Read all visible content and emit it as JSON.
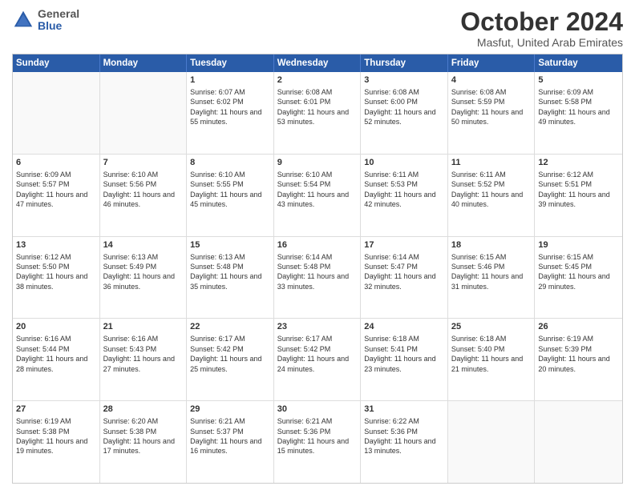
{
  "logo": {
    "general": "General",
    "blue": "Blue"
  },
  "title": "October 2024",
  "location": "Masfut, United Arab Emirates",
  "days": [
    "Sunday",
    "Monday",
    "Tuesday",
    "Wednesday",
    "Thursday",
    "Friday",
    "Saturday"
  ],
  "weeks": [
    [
      {
        "day": "",
        "sunrise": "",
        "sunset": "",
        "daylight": ""
      },
      {
        "day": "",
        "sunrise": "",
        "sunset": "",
        "daylight": ""
      },
      {
        "day": "1",
        "sunrise": "Sunrise: 6:07 AM",
        "sunset": "Sunset: 6:02 PM",
        "daylight": "Daylight: 11 hours and 55 minutes."
      },
      {
        "day": "2",
        "sunrise": "Sunrise: 6:08 AM",
        "sunset": "Sunset: 6:01 PM",
        "daylight": "Daylight: 11 hours and 53 minutes."
      },
      {
        "day": "3",
        "sunrise": "Sunrise: 6:08 AM",
        "sunset": "Sunset: 6:00 PM",
        "daylight": "Daylight: 11 hours and 52 minutes."
      },
      {
        "day": "4",
        "sunrise": "Sunrise: 6:08 AM",
        "sunset": "Sunset: 5:59 PM",
        "daylight": "Daylight: 11 hours and 50 minutes."
      },
      {
        "day": "5",
        "sunrise": "Sunrise: 6:09 AM",
        "sunset": "Sunset: 5:58 PM",
        "daylight": "Daylight: 11 hours and 49 minutes."
      }
    ],
    [
      {
        "day": "6",
        "sunrise": "Sunrise: 6:09 AM",
        "sunset": "Sunset: 5:57 PM",
        "daylight": "Daylight: 11 hours and 47 minutes."
      },
      {
        "day": "7",
        "sunrise": "Sunrise: 6:10 AM",
        "sunset": "Sunset: 5:56 PM",
        "daylight": "Daylight: 11 hours and 46 minutes."
      },
      {
        "day": "8",
        "sunrise": "Sunrise: 6:10 AM",
        "sunset": "Sunset: 5:55 PM",
        "daylight": "Daylight: 11 hours and 45 minutes."
      },
      {
        "day": "9",
        "sunrise": "Sunrise: 6:10 AM",
        "sunset": "Sunset: 5:54 PM",
        "daylight": "Daylight: 11 hours and 43 minutes."
      },
      {
        "day": "10",
        "sunrise": "Sunrise: 6:11 AM",
        "sunset": "Sunset: 5:53 PM",
        "daylight": "Daylight: 11 hours and 42 minutes."
      },
      {
        "day": "11",
        "sunrise": "Sunrise: 6:11 AM",
        "sunset": "Sunset: 5:52 PM",
        "daylight": "Daylight: 11 hours and 40 minutes."
      },
      {
        "day": "12",
        "sunrise": "Sunrise: 6:12 AM",
        "sunset": "Sunset: 5:51 PM",
        "daylight": "Daylight: 11 hours and 39 minutes."
      }
    ],
    [
      {
        "day": "13",
        "sunrise": "Sunrise: 6:12 AM",
        "sunset": "Sunset: 5:50 PM",
        "daylight": "Daylight: 11 hours and 38 minutes."
      },
      {
        "day": "14",
        "sunrise": "Sunrise: 6:13 AM",
        "sunset": "Sunset: 5:49 PM",
        "daylight": "Daylight: 11 hours and 36 minutes."
      },
      {
        "day": "15",
        "sunrise": "Sunrise: 6:13 AM",
        "sunset": "Sunset: 5:48 PM",
        "daylight": "Daylight: 11 hours and 35 minutes."
      },
      {
        "day": "16",
        "sunrise": "Sunrise: 6:14 AM",
        "sunset": "Sunset: 5:48 PM",
        "daylight": "Daylight: 11 hours and 33 minutes."
      },
      {
        "day": "17",
        "sunrise": "Sunrise: 6:14 AM",
        "sunset": "Sunset: 5:47 PM",
        "daylight": "Daylight: 11 hours and 32 minutes."
      },
      {
        "day": "18",
        "sunrise": "Sunrise: 6:15 AM",
        "sunset": "Sunset: 5:46 PM",
        "daylight": "Daylight: 11 hours and 31 minutes."
      },
      {
        "day": "19",
        "sunrise": "Sunrise: 6:15 AM",
        "sunset": "Sunset: 5:45 PM",
        "daylight": "Daylight: 11 hours and 29 minutes."
      }
    ],
    [
      {
        "day": "20",
        "sunrise": "Sunrise: 6:16 AM",
        "sunset": "Sunset: 5:44 PM",
        "daylight": "Daylight: 11 hours and 28 minutes."
      },
      {
        "day": "21",
        "sunrise": "Sunrise: 6:16 AM",
        "sunset": "Sunset: 5:43 PM",
        "daylight": "Daylight: 11 hours and 27 minutes."
      },
      {
        "day": "22",
        "sunrise": "Sunrise: 6:17 AM",
        "sunset": "Sunset: 5:42 PM",
        "daylight": "Daylight: 11 hours and 25 minutes."
      },
      {
        "day": "23",
        "sunrise": "Sunrise: 6:17 AM",
        "sunset": "Sunset: 5:42 PM",
        "daylight": "Daylight: 11 hours and 24 minutes."
      },
      {
        "day": "24",
        "sunrise": "Sunrise: 6:18 AM",
        "sunset": "Sunset: 5:41 PM",
        "daylight": "Daylight: 11 hours and 23 minutes."
      },
      {
        "day": "25",
        "sunrise": "Sunrise: 6:18 AM",
        "sunset": "Sunset: 5:40 PM",
        "daylight": "Daylight: 11 hours and 21 minutes."
      },
      {
        "day": "26",
        "sunrise": "Sunrise: 6:19 AM",
        "sunset": "Sunset: 5:39 PM",
        "daylight": "Daylight: 11 hours and 20 minutes."
      }
    ],
    [
      {
        "day": "27",
        "sunrise": "Sunrise: 6:19 AM",
        "sunset": "Sunset: 5:38 PM",
        "daylight": "Daylight: 11 hours and 19 minutes."
      },
      {
        "day": "28",
        "sunrise": "Sunrise: 6:20 AM",
        "sunset": "Sunset: 5:38 PM",
        "daylight": "Daylight: 11 hours and 17 minutes."
      },
      {
        "day": "29",
        "sunrise": "Sunrise: 6:21 AM",
        "sunset": "Sunset: 5:37 PM",
        "daylight": "Daylight: 11 hours and 16 minutes."
      },
      {
        "day": "30",
        "sunrise": "Sunrise: 6:21 AM",
        "sunset": "Sunset: 5:36 PM",
        "daylight": "Daylight: 11 hours and 15 minutes."
      },
      {
        "day": "31",
        "sunrise": "Sunrise: 6:22 AM",
        "sunset": "Sunset: 5:36 PM",
        "daylight": "Daylight: 11 hours and 13 minutes."
      },
      {
        "day": "",
        "sunrise": "",
        "sunset": "",
        "daylight": ""
      },
      {
        "day": "",
        "sunrise": "",
        "sunset": "",
        "daylight": ""
      }
    ]
  ]
}
